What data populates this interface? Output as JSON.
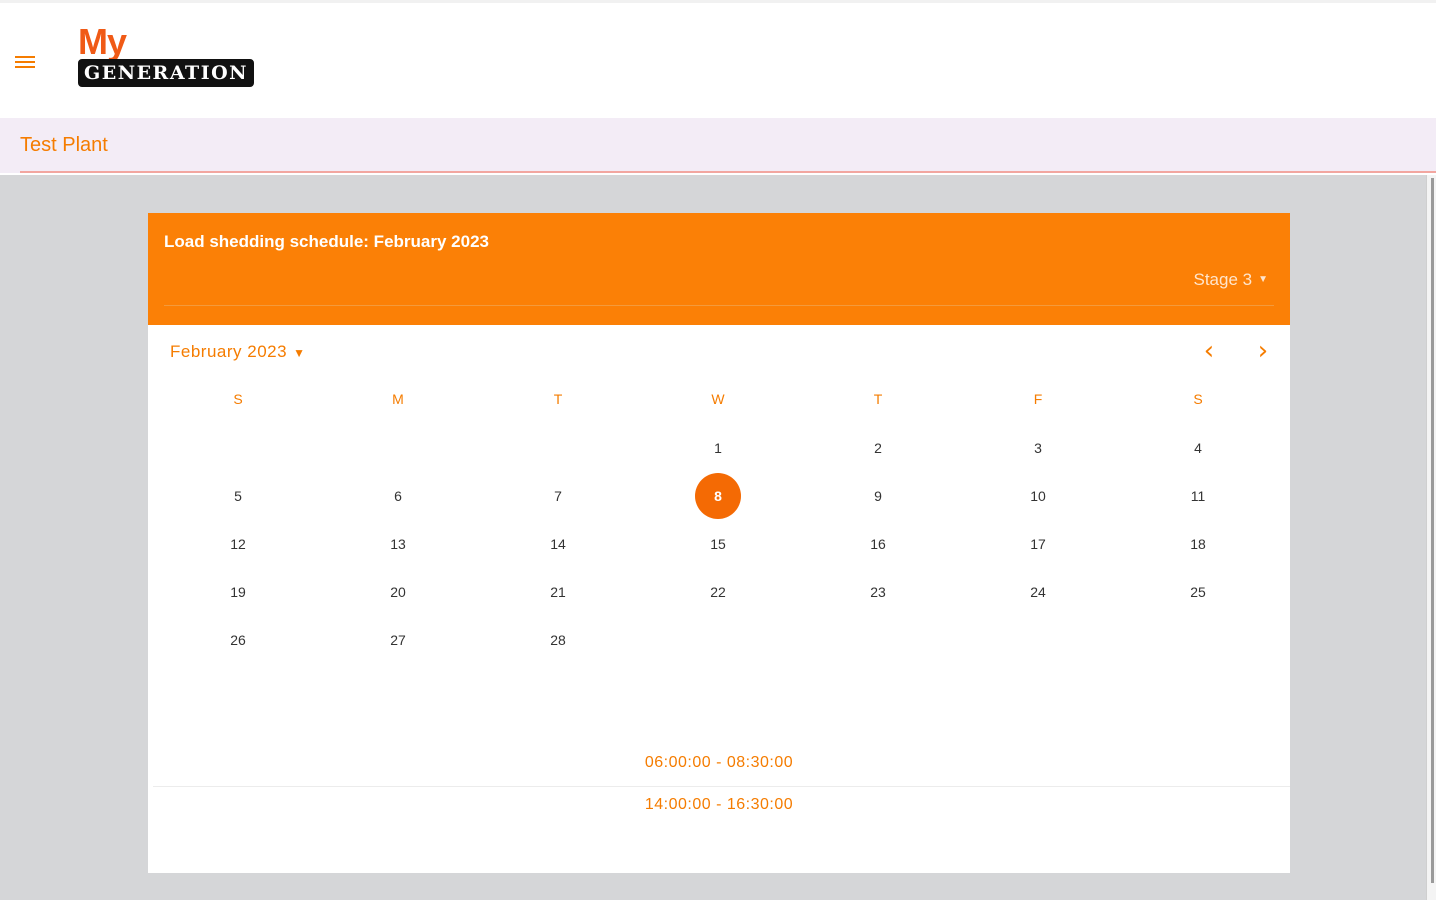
{
  "header": {
    "logo_top": "My",
    "logo_bottom": "GENERATION"
  },
  "plant": {
    "name": "Test Plant"
  },
  "card": {
    "title": "Load shedding schedule: February 2023",
    "stage": "Stage 3",
    "month_label": "February 2023",
    "weekdays": [
      "S",
      "M",
      "T",
      "W",
      "T",
      "F",
      "S"
    ],
    "days": [
      "1",
      "2",
      "3",
      "4",
      "5",
      "6",
      "7",
      "8",
      "9",
      "10",
      "11",
      "12",
      "13",
      "14",
      "15",
      "16",
      "17",
      "18",
      "19",
      "20",
      "21",
      "22",
      "23",
      "24",
      "25",
      "26",
      "27",
      "28"
    ],
    "selected_day": "8",
    "time_slots": [
      "06:00:00 - 08:30:00",
      "14:00:00 - 16:30:00"
    ]
  },
  "colors": {
    "accent": "#fb8006",
    "logo_red": "#f05a16",
    "plant_bar": "#f3ecf6",
    "background": "#d5d6d8"
  },
  "icons": {
    "menu": "menu-icon",
    "prev": "chevron-left-icon",
    "next": "chevron-right-icon",
    "dropdown": "caret-down-icon"
  }
}
